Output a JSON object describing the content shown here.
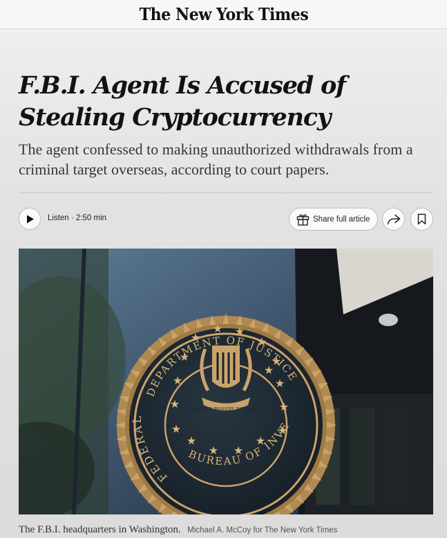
{
  "masthead": {
    "logo_text": "The New York Times"
  },
  "article": {
    "headline": "F.B.I. Agent Is Accused of Stealing Cryptocurrency",
    "summary": "The agent confessed to making unauthorized withdrawals from a criminal target overseas, according to court papers."
  },
  "toolbar": {
    "listen_label": "Listen · 2:50 min",
    "share_label": "Share full article",
    "icons": [
      "play-icon",
      "gift-icon",
      "share-arrow-icon",
      "bookmark-icon"
    ]
  },
  "photo": {
    "seal_top_text": "DEPARTMENT OF JUSTICE",
    "seal_left_text": "FEDERAL",
    "seal_bottom_text": "BUREAU OF INVESTIGATION",
    "seal_ribbon_text": "FIDELITY BRAVERY INTEGRITY"
  },
  "caption": {
    "text": "The F.B.I. headquarters in Washington.",
    "credit": "Michael A. McCoy for The New York Times"
  },
  "colors": {
    "text": "#121212",
    "background": "#e4e4e4",
    "seal_gold": "#c9a46a"
  }
}
